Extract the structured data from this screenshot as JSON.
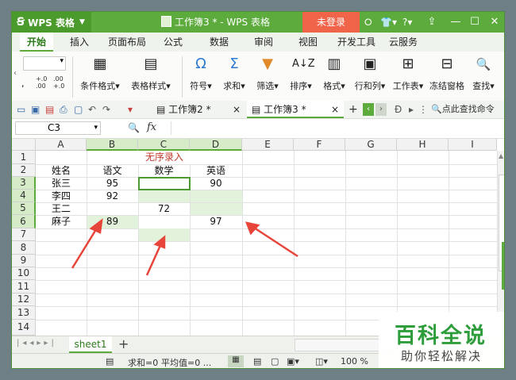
{
  "app": {
    "name": "WPS 表格",
    "window_title": "工作簿3 * - WPS 表格",
    "login": "未登录"
  },
  "title_icons": [
    "⭘",
    "👕",
    "?"
  ],
  "tabs": [
    "开始",
    "插入",
    "页面布局",
    "公式",
    "数据",
    "审阅",
    "视图",
    "开发工具",
    "云服务"
  ],
  "ribbon": {
    "cond_format": "条件格式",
    "table_style": "表格样式",
    "symbol": "符号",
    "sum": "求和",
    "filter": "筛选",
    "sort": "排序",
    "format": "格式",
    "rowcol": "行和列",
    "worksheet": "工作表",
    "freeze": "冻结窗格",
    "find": "查找"
  },
  "doc_tabs": [
    {
      "name": "工作簿2 *"
    },
    {
      "name": "工作簿3 *"
    }
  ],
  "search_cmd": "点此查找命令",
  "name_box": "C3",
  "fx": "fx",
  "columns": [
    "A",
    "B",
    "C",
    "D",
    "E",
    "F",
    "G",
    "H",
    "I"
  ],
  "rows": [
    "1",
    "2",
    "3",
    "4",
    "5",
    "6",
    "7",
    "8",
    "9",
    "10",
    "11",
    "12",
    "13",
    "14"
  ],
  "sheet": {
    "title": "无序录入",
    "headers": [
      "姓名",
      "语文",
      "数学",
      "英语"
    ],
    "data": [
      [
        "张三",
        "95",
        "",
        "90"
      ],
      [
        "李四",
        "92",
        "",
        ""
      ],
      [
        "王二",
        "",
        "72",
        ""
      ],
      [
        "麻子",
        "89",
        "",
        "97"
      ]
    ]
  },
  "sheet_tab": "sheet1",
  "status": {
    "sum": "求和=0",
    "avg": "平均值=0 ...",
    "zoom": "100 %"
  },
  "watermark": {
    "line1": "百科全说",
    "line2": "助你轻松解决"
  },
  "colors": {
    "accent": "#5cab3c",
    "login": "#f0644a",
    "arrow": "#e8453a",
    "title_red": "#c0392b"
  }
}
